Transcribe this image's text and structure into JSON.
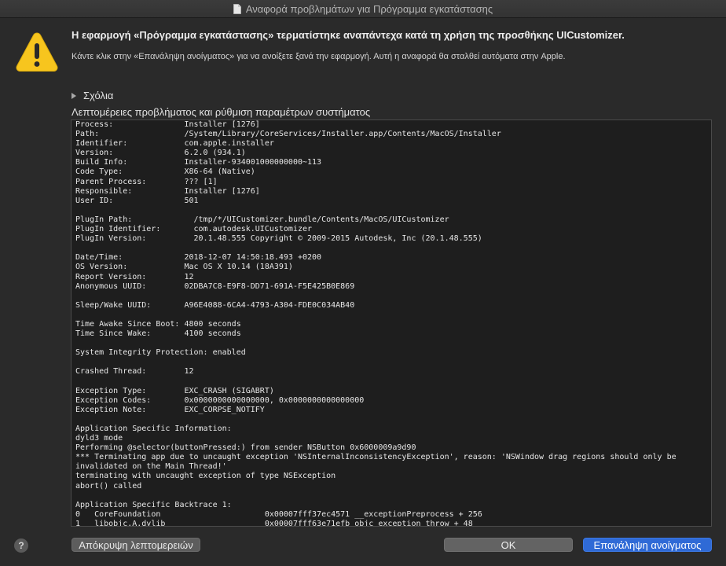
{
  "window": {
    "title": "Αναφορά προβλημάτων για Πρόγραμμα εγκατάστασης",
    "icon": "document-icon"
  },
  "alert": {
    "icon": "warning-icon",
    "headline": "Η εφαρμογή «Πρόγραμμα εγκατάστασης» τερματίστηκε αναπάντεχα κατά τη χρήση της προσθήκης UICustomizer.",
    "message": "Κάντε κλικ στην «Επανάληψη ανοίγματος» για να ανοίξετε ξανά την εφαρμογή. Αυτή η αναφορά θα σταλθεί αυτόματα στην Apple."
  },
  "comments": {
    "label": "Σχόλια"
  },
  "details": {
    "label": "Λεπτομέρειες προβλήματος και ρύθμιση παραμέτρων συστήματος",
    "report": "Process:               Installer [1276]\nPath:                  /System/Library/CoreServices/Installer.app/Contents/MacOS/Installer\nIdentifier:            com.apple.installer\nVersion:               6.2.0 (934.1)\nBuild Info:            Installer-934001000000000~113\nCode Type:             X86-64 (Native)\nParent Process:        ??? [1]\nResponsible:           Installer [1276]\nUser ID:               501\n\nPlugIn Path:             /tmp/*/UICustomizer.bundle/Contents/MacOS/UICustomizer\nPlugIn Identifier:       com.autodesk.UICustomizer\nPlugIn Version:          20.1.48.555 Copyright © 2009-2015 Autodesk, Inc (20.1.48.555)\n\nDate/Time:             2018-12-07 14:50:18.493 +0200\nOS Version:            Mac OS X 10.14 (18A391)\nReport Version:        12\nAnonymous UUID:        02DBA7C8-E9F8-DD71-691A-F5E425B0E869\n\nSleep/Wake UUID:       A96E4088-6CA4-4793-A304-FDE0C034AB40\n\nTime Awake Since Boot: 4800 seconds\nTime Since Wake:       4100 seconds\n\nSystem Integrity Protection: enabled\n\nCrashed Thread:        12\n\nException Type:        EXC_CRASH (SIGABRT)\nException Codes:       0x0000000000000000, 0x0000000000000000\nException Note:        EXC_CORPSE_NOTIFY\n\nApplication Specific Information:\ndyld3 mode\nPerforming @selector(buttonPressed:) from sender NSButton 0x6000009a9d90\n*** Terminating app due to uncaught exception 'NSInternalInconsistencyException', reason: 'NSWindow drag regions should only be invalidated on the Main Thread!'\nterminating with uncaught exception of type NSException\nabort() called\n\nApplication Specific Backtrace 1:\n0   CoreFoundation                      0x00007fff37ec4571 __exceptionPreprocess + 256\n1   libobjc.A.dylib                     0x00007fff63e71efb objc_exception_throw + 48"
  },
  "buttons": {
    "help": "?",
    "hide_details": "Απόκρυψη λεπτομερειών",
    "ok": "OK",
    "reopen": "Επανάληψη ανοίγματος"
  },
  "colors": {
    "background": "#2a2a2a",
    "report_bg": "#1e1e1e",
    "primary_button": "#2f6ad6",
    "warning_yellow": "#f5c518"
  }
}
